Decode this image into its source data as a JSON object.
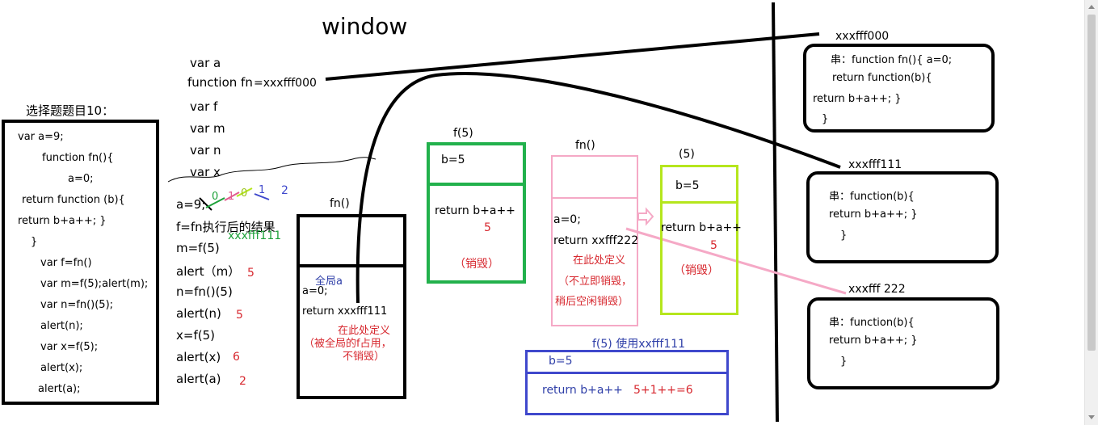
{
  "title": "window",
  "left_panel": {
    "heading": "选择题题目10：",
    "code": [
      "var a=9;",
      "function fn(){",
      "a=0;",
      "return function (b){",
      "return b+a++; }",
      "}",
      "var f=fn()",
      "var m=f(5);alert(m);",
      "var n=fn()(5);",
      "alert(n);",
      "var x=f(5);",
      "alert(x);",
      "alert(a);"
    ]
  },
  "window_vars": {
    "var_a": "var a",
    "function_fn": "function fn",
    "fn_addr": "=xxxfff000",
    "var_f": "var f",
    "var_m": "var m",
    "var_n": "var n",
    "var_x": "var x"
  },
  "exec": {
    "a9": "a=9;",
    "a_values": [
      "0",
      "1",
      "0",
      "1",
      "2"
    ],
    "f_assign": "f=fn执行后的结果",
    "f_addr": "xxxfff111",
    "m_assign": "m=f(5)",
    "alert_m": "alert（m）",
    "m_val": "5",
    "n_assign": "n=fn()(5)",
    "alert_n": "alert(n)",
    "n_val": "5",
    "x_assign": "x=f(5)",
    "alert_x": "alert(x)",
    "x_val": "6",
    "alert_a": "alert(a)",
    "a_val": "2"
  },
  "fn_scope1": {
    "label": "fn()",
    "global_label": "全局a",
    "a0": "a=0;",
    "ret": "return xxxfff111",
    "note1": "在此处定义",
    "note2": "（被全局的f占用，",
    "note3": "不销毁）"
  },
  "f5_scope": {
    "label": "f(5)",
    "b": "b=5",
    "ret": "return b+a++",
    "val": "5",
    "note": "（销毁）"
  },
  "fn_scope2": {
    "label": "fn()",
    "a0": "a=0;",
    "ret": "return xxfff222",
    "note1": "在此处定义",
    "note2": "（不立即销毁，",
    "note3": "稍后空闲销毁）"
  },
  "call5_scope": {
    "label": "(5)",
    "b": "b=5",
    "ret": "return b+a++",
    "val": "5",
    "note": "（销毁）"
  },
  "f5_use": {
    "label": "f(5) 使用xxfff111",
    "b": "b=5",
    "ret": "return b+a++",
    "calc": "5+1++=6"
  },
  "heap": {
    "h1": {
      "addr": "xxxfff000",
      "line1": "串：function fn(){  a=0;",
      "line2": "return function(b){",
      "line3": "return b+a++; }",
      "line4": "}"
    },
    "h2": {
      "addr": "xxxfff111",
      "line1": "串：function(b){",
      "line2": "return b+a++; }",
      "line3": "}"
    },
    "h3": {
      "addr": "xxxfff 222",
      "line1": "串：function(b){",
      "line2": "return b+a++; }",
      "line3": "}"
    }
  },
  "colors": {
    "black": "#000000",
    "green": "#22b14c",
    "pink": "#f5a9c6",
    "lime": "#b5e61d",
    "blue": "#3f48cc",
    "red": "#d7282f"
  }
}
